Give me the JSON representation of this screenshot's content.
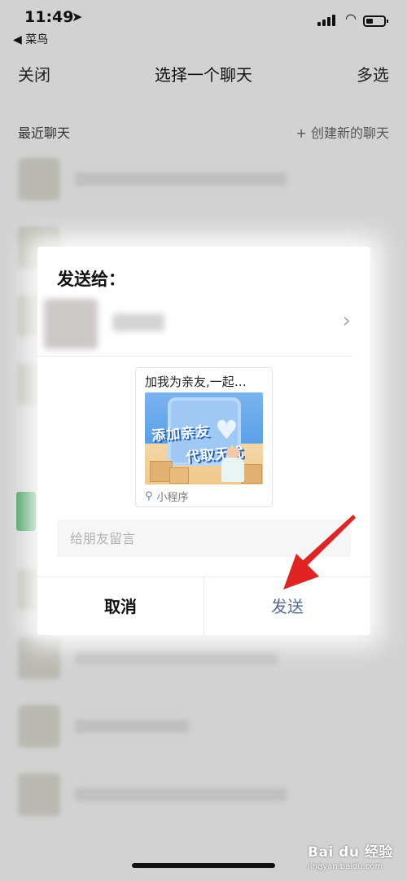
{
  "status_bar": {
    "time": "11:49",
    "location_arrow": "location-arrow-icon",
    "back_app": "◀ 菜鸟"
  },
  "navbar": {
    "close_label": "关闭",
    "title": "选择一个聊天",
    "multi_label": "多选"
  },
  "section": {
    "title": "最近聊天",
    "new_chat_label": "+ 创建新的聊天"
  },
  "modal": {
    "title": "发送给：",
    "card": {
      "title": "加我为亲友,一起…",
      "banner_line1": "添加亲友",
      "banner_line2": "代取无忧",
      "footer_label": "小程序"
    },
    "message_placeholder": "给朋友留言",
    "cancel_label": "取消",
    "send_label": "发送"
  },
  "watermark": {
    "logo": "Bai du 经验",
    "url": "jingyan.baidu.com"
  },
  "colors": {
    "send_text": "#576b95",
    "annotation_arrow": "#e02424",
    "tag_green": "#3e9b57"
  }
}
